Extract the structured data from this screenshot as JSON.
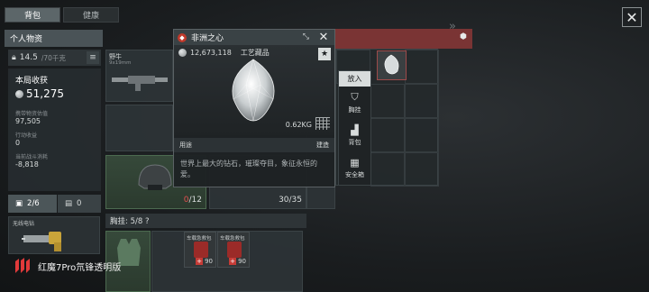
{
  "tabs": [
    {
      "label": "背包",
      "active": true
    },
    {
      "label": "健康",
      "active": false
    }
  ],
  "top_right": {
    "chevron": "»",
    "close_icon": "close-icon"
  },
  "left_panel": {
    "header": "个人物资",
    "weight_value": "14.5",
    "weight_unit": "/70千克",
    "stats_title": "本局收获",
    "harvest_value": "51,275",
    "carried_label": "携带物资估值",
    "carried_value": "97,505",
    "action_income_label": "行动收益",
    "action_income_value": "0",
    "current_income_label": "当前战斗消耗",
    "current_income_value": "-8,818"
  },
  "sub_tabs": [
    {
      "label": "2/6",
      "icon": "backpack-icon",
      "active": true
    },
    {
      "label": "0",
      "icon": "pouch-icon",
      "active": false
    }
  ],
  "tool_slot": {
    "name": "无线电钻"
  },
  "inventory": {
    "gun_name": "野牛",
    "gun_sub": "9x19mm",
    "helmet_count": "0",
    "helmet_max": "/12",
    "armor_count": "30/35",
    "chest_header": "胸挂: 5/8 ?"
  },
  "medkits": [
    {
      "title": "车载急救包",
      "count": "90"
    },
    {
      "title": "车载急救包",
      "count": "90"
    }
  ],
  "detail": {
    "title": "非洲之心",
    "price": "12,673,118",
    "category": "工艺藏品",
    "weight": "0.62KG",
    "usage_left": "用途",
    "usage_right": "建造",
    "description": "世界上最大的钻石，璀璨夺目，象征永恒的爱。",
    "star": "★"
  },
  "action_menu": {
    "put_label": "放入",
    "items": [
      {
        "label": "胸挂",
        "icon": "vest-icon"
      },
      {
        "label": "背包",
        "icon": "backpack-icon"
      },
      {
        "label": "安全箱",
        "icon": "safebox-icon"
      }
    ]
  },
  "watermark": "红魔7Pro氘锋透明版",
  "colors": {
    "accent_red": "#7a3434",
    "text": "#d8dcdc",
    "panel": "#2e3437",
    "health_red": "#c63b36"
  }
}
